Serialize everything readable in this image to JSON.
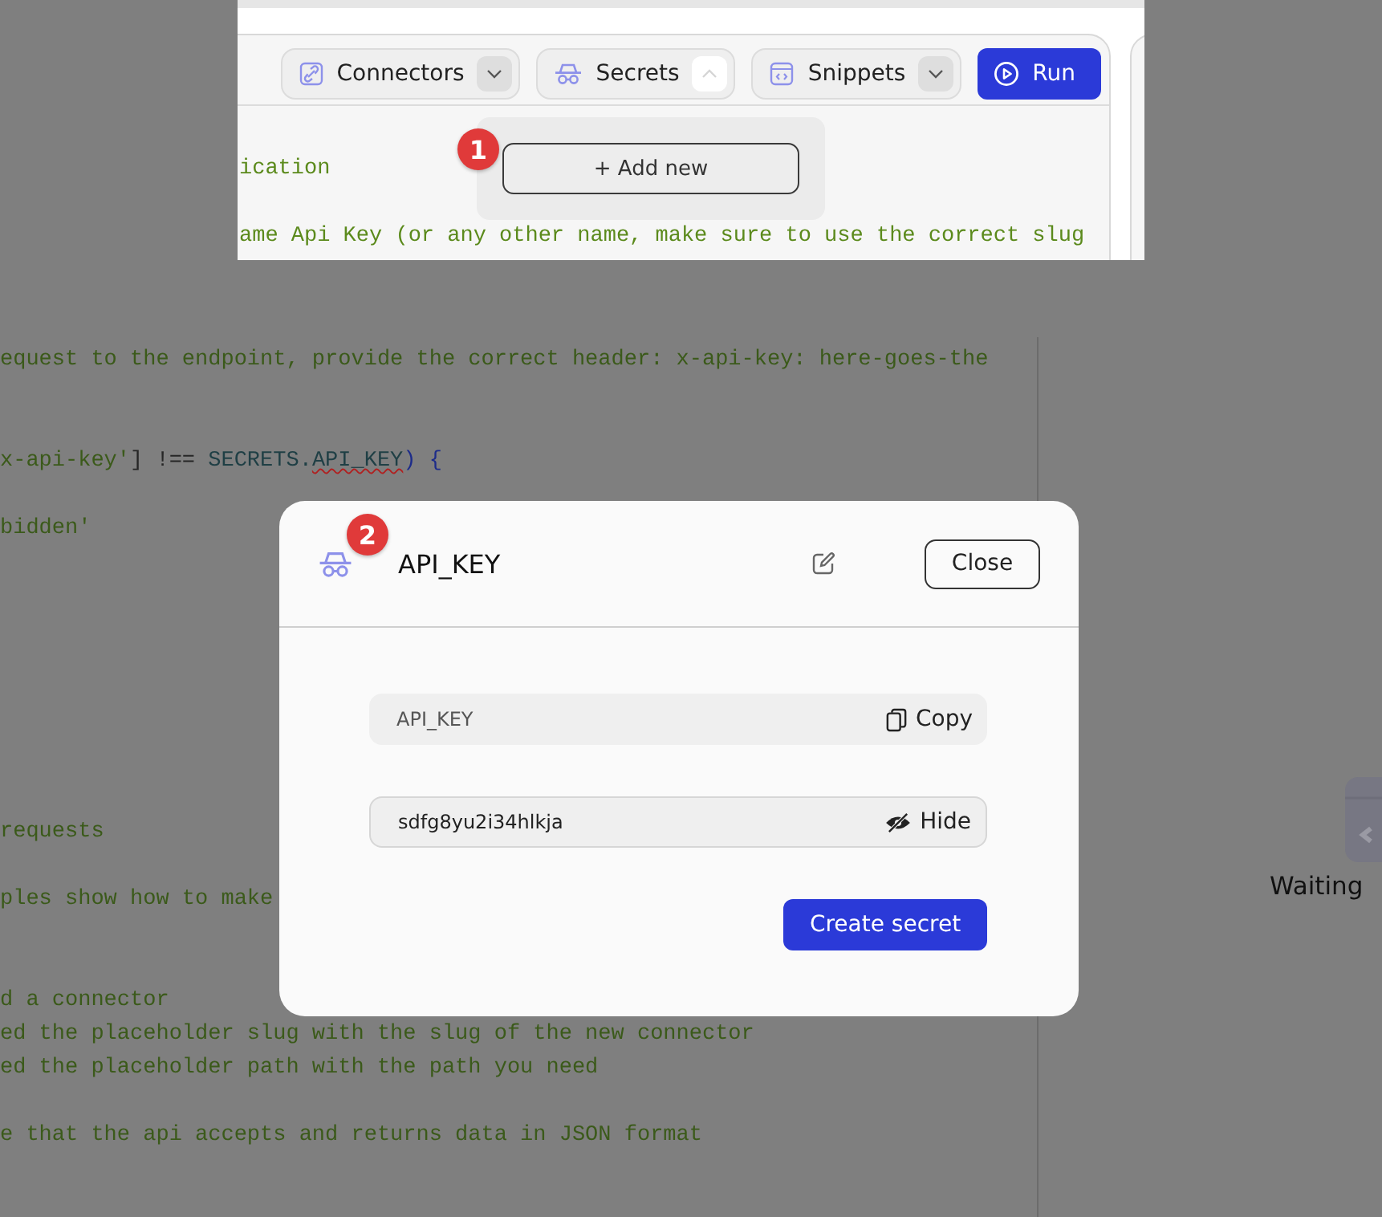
{
  "inset": {
    "toolbar": [
      {
        "label": "Connectors",
        "kind": "connectors",
        "expanded": false
      },
      {
        "label": "Secrets",
        "kind": "secrets",
        "expanded": true
      },
      {
        "label": "Snippets",
        "kind": "snippets",
        "expanded": false
      }
    ],
    "run_button": "Run",
    "code_lines": [
      "ication",
      "ame Api Key (or any other name, make sure to use the correct slug"
    ],
    "popover": {
      "button": "+ Add new",
      "step_badge": "1"
    }
  },
  "editor": {
    "code_lines": [
      {
        "tokens": [
          {
            "text": "equest to the endpoint, provide the correct header: x-api-key: here-goes-the",
            "kind": "comment"
          }
        ]
      },
      {
        "tokens": [
          {
            "text": "x-api-key'",
            "kind": "string"
          },
          {
            "text": "] !== ",
            "kind": "plain"
          },
          {
            "text": "SECRETS.",
            "kind": "ident"
          },
          {
            "text": "API_KEY",
            "kind": "error"
          },
          {
            "text": ") {",
            "kind": "brace"
          }
        ]
      },
      {
        "tokens": [
          {
            "text": "bidden'",
            "kind": "string"
          }
        ]
      },
      {
        "tokens": [
          {
            "text": "requests",
            "kind": "comment"
          }
        ]
      },
      {
        "tokens": [
          {
            "text": "ples show how to make",
            "kind": "comment"
          }
        ]
      },
      {
        "tokens": [
          {
            "text": "d a connector",
            "kind": "comment"
          }
        ]
      },
      {
        "tokens": [
          {
            "text": "ed the placeholder slug with the slug of the new connector",
            "kind": "comment"
          }
        ]
      },
      {
        "tokens": [
          {
            "text": "ed the placeholder path with the path you need",
            "kind": "comment"
          }
        ]
      },
      {
        "tokens": [
          {
            "text": "e that the api accepts and returns data in JSON format",
            "kind": "comment"
          }
        ]
      }
    ]
  },
  "right_panel": {
    "status": "Waiting"
  },
  "modal": {
    "title": "API_KEY",
    "step_badge": "2",
    "close_button": "Close",
    "fields": [
      {
        "value": "API_KEY",
        "action": "Copy",
        "kind": "copy"
      },
      {
        "value": "sdfg8yu2i34hlkja",
        "action": "Hide",
        "kind": "reveal"
      }
    ],
    "submit_button": "Create secret"
  }
}
